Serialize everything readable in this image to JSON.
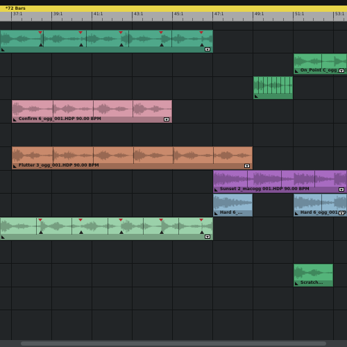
{
  "loop": {
    "label": "*72 Bars"
  },
  "ruler": {
    "ticks": [
      "37:1",
      "39:1",
      "41:1",
      "43:1",
      "45:1",
      "47:1",
      "49:1",
      "51:1",
      "53:1"
    ]
  },
  "colors": {
    "teal": "#4fa88a",
    "pink": "#d79aa9",
    "orange": "#c98a6c",
    "purple": "#a86bc1",
    "blue": "#90b7cf",
    "lightgreen": "#9bd1aa",
    "green": "#54b47a"
  },
  "clips": [
    {
      "id": "teal-loop",
      "color": "teal",
      "label": "",
      "segments": 5,
      "markers": true
    },
    {
      "id": "onpoint",
      "color": "green",
      "label": "On_Point C_ogg_001.HDP",
      "segments": 2,
      "markers": false
    },
    {
      "id": "stabs",
      "color": "green",
      "label": "",
      "segments": 9,
      "markers": false
    },
    {
      "id": "confirm",
      "color": "pink",
      "label": "Confirm 6_ogg_001.HDP   90.00 BPM",
      "segments": 4,
      "markers": false
    },
    {
      "id": "flutter",
      "color": "orange",
      "label": "Flutter 3_ogg_001.HDP   90.00 BPM",
      "segments": 6,
      "markers": false
    },
    {
      "id": "sunset",
      "color": "purple",
      "label": "Sunset 2_macogg 001.HDP   90.00 BPM",
      "segments": 4,
      "markers": false
    },
    {
      "id": "hard-a",
      "color": "blue",
      "label": "Hard 6_...",
      "segments": 1,
      "markers": false
    },
    {
      "id": "hard-b",
      "color": "blue",
      "label": "Hard 6_ogg_001.HDP",
      "segments": 2,
      "markers": false
    },
    {
      "id": "green-loop",
      "color": "lightgreen",
      "label": "",
      "segments": 6,
      "markers": true
    },
    {
      "id": "scratch",
      "color": "green",
      "label": "Scratch...",
      "segments": 1,
      "markers": false
    }
  ]
}
